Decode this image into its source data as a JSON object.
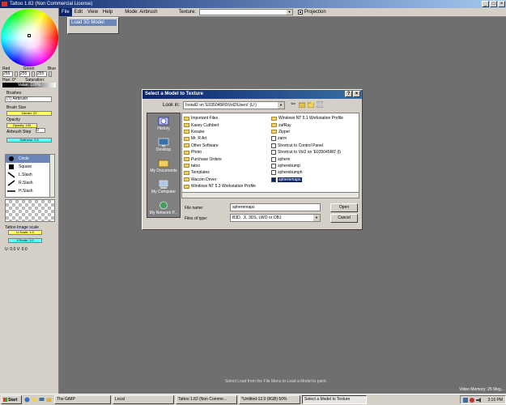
{
  "window": {
    "title": "Tattoo 1.82 (Non Commercial License)",
    "minimize": "_",
    "maximize": "□",
    "close": "×"
  },
  "menu": {
    "items": [
      "File",
      "Edit",
      "View",
      "Help"
    ],
    "mode": "Mode: Airbrush",
    "texture_label": "Texture:",
    "texture_value": "",
    "projection_label": "Projection"
  },
  "dropdown": {
    "item": "Load 3D Model"
  },
  "panel": {
    "rgb_labels": [
      "Red",
      "Green",
      "Blue"
    ],
    "rgb_values": [
      "255",
      "255",
      "255"
    ],
    "hue": "Hue: 0°",
    "saturation": "Saturation: 0%",
    "value": "Value: 100%",
    "brushes_label": "Brushes",
    "brushes_value": "(T) Airbrush",
    "brush_size_label": "Brush Size",
    "brush_size_value": "1brush: 22",
    "opacity_label": "Opacity",
    "opacity_value": "Opacity: 100",
    "airbrush_step_label": "Airbrush Step",
    "airbrush_step_value": "0",
    "softness_value": "Softness: 0.5",
    "brush_shapes": [
      "Circle",
      "Square",
      "L.Slash",
      "R.Slash",
      "H.Slash",
      "V.Slash"
    ],
    "image_scale_label": "Tattoo Image scale",
    "uscale": "U.Scale: 1.0",
    "vscale": "V.Scale: 1.0",
    "uv": "U: 0.0 V: 0.0"
  },
  "dialog": {
    "title": "Select a Model to Texture",
    "help_btn": "?",
    "close_btn": "×",
    "look_in_label": "Look in:",
    "look_in_value": "Install2 on 'E035045R0\\Vol2\\Users' (U:)",
    "places": [
      "History",
      "Desktop",
      "My Documents",
      "My Computer",
      "My Network P..."
    ],
    "files_left": [
      "Important Files",
      "Kasey Cuthbert",
      "Kesuke",
      "Mr. R Art",
      "Other Software",
      "Photo",
      "Purchase Orders",
      "tatoo",
      "Templates",
      "Wacom Driver",
      "Windows NT 5.3 Workstation Profile"
    ],
    "files_right": [
      "Windows NT 5.1 Workstation Profile",
      "zafRay",
      "Zipper",
      "zarm",
      "Shortcut to Control Panel",
      "Shortcut to Vol2 on 'E035045R0' (I)",
      "sphere",
      "spherebump",
      "spherebumph",
      "spheremaps"
    ],
    "file_name_label": "File name:",
    "file_name_value": "spheremaps",
    "file_type_label": "Files of type:",
    "file_type_value": "B3D, .X, 3DS, LWO or OBJ",
    "open_btn": "Open",
    "cancel_btn": "Cancel"
  },
  "status": {
    "message": "Select Load from the File Menu to Load a Model to paint.",
    "memory": "Video Memory: 25 Meg..."
  },
  "taskbar": {
    "start": "Start",
    "tasks": [
      "The GIMP",
      "Local",
      "Tattoo 1.82 (Non Comme...",
      "*Untitled-12.0 (8GB) 50%",
      "Select a Model to Texture"
    ],
    "clock": "3:16 PM"
  },
  "colors": {
    "titlebar": "#0a246a",
    "workspace": "#6f6f6f",
    "panel": "#d4d0c8",
    "selection": "#0a246a"
  }
}
